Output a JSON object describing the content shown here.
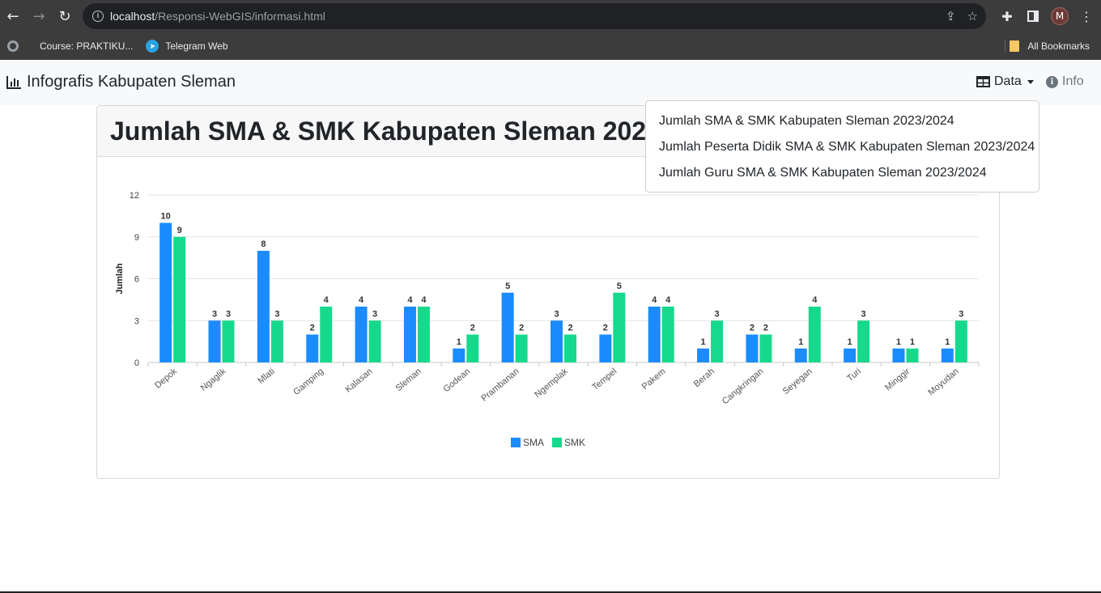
{
  "browser": {
    "url_host": "localhost",
    "url_path": "/Responsi-WebGIS/informasi.html",
    "profile_initial": "M"
  },
  "bookmarks": {
    "items": [
      {
        "label": "Course: PRAKTIKU..."
      },
      {
        "label": "Telegram Web"
      }
    ],
    "all_bookmarks": "All Bookmarks"
  },
  "navbar": {
    "brand": "Infografis Kabupaten Sleman",
    "data_label": "Data",
    "info_label": "Info"
  },
  "dropdown": {
    "items": [
      {
        "label": "Jumlah SMA & SMK Kabupaten Sleman 2023/2024"
      },
      {
        "label": "Jumlah Peserta Didik SMA & SMK Kabupaten Sleman 2023/2024"
      },
      {
        "label": "Jumlah Guru SMA & SMK Kabupaten Sleman 2023/2024"
      }
    ]
  },
  "card": {
    "title": "Jumlah SMA & SMK Kabupaten Sleman 2023/2024"
  },
  "chart_data": {
    "type": "bar",
    "categories": [
      "Depok",
      "Ngaglik",
      "Mlati",
      "Gamping",
      "Kalasan",
      "Sleman",
      "Godean",
      "Prambanan",
      "Ngemplak",
      "Tempel",
      "Pakem",
      "Berah",
      "Cangkringan",
      "Seyegan",
      "Turi",
      "Minggir",
      "Moyudan"
    ],
    "series": [
      {
        "name": "SMA",
        "color": "#1a8cff",
        "values": [
          10,
          3,
          8,
          2,
          4,
          4,
          1,
          5,
          3,
          2,
          4,
          1,
          2,
          1,
          1,
          1,
          1
        ]
      },
      {
        "name": "SMK",
        "color": "#17d98c",
        "values": [
          9,
          3,
          3,
          4,
          3,
          4,
          2,
          2,
          2,
          5,
          4,
          3,
          2,
          4,
          3,
          1,
          3
        ]
      }
    ],
    "ylabel": "Jumlah",
    "ylim": [
      0,
      12
    ],
    "yticks": [
      0,
      3,
      6,
      9,
      12
    ],
    "grid": true,
    "legend": "bottom-center"
  }
}
